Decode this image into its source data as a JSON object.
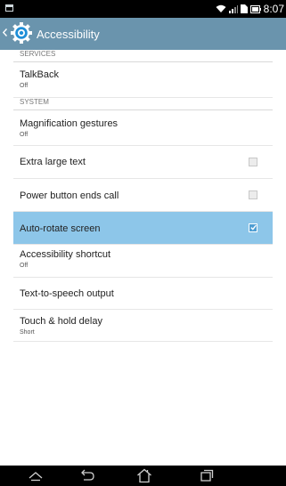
{
  "status_bar": {
    "time": "8:07",
    "icons": [
      "notification-icon",
      "wifi-icon",
      "signal-icon",
      "sim-icon",
      "battery-icon"
    ]
  },
  "action_bar": {
    "title": "Accessibility",
    "background": "#6a94ad",
    "icon": "settings-gear-icon"
  },
  "sections": {
    "services": {
      "header": "SERVICES",
      "items": [
        {
          "title": "TalkBack",
          "summary": "Off"
        }
      ]
    },
    "system": {
      "header": "SYSTEM",
      "items": [
        {
          "title": "Magnification gestures",
          "summary": "Off"
        },
        {
          "title": "Extra large text",
          "checked": false
        },
        {
          "title": "Power button ends call",
          "checked": false
        },
        {
          "title": "Auto-rotate screen",
          "checked": true,
          "selected": true
        },
        {
          "title": "Accessibility shortcut",
          "summary": "Off"
        },
        {
          "title": "Text-to-speech output"
        },
        {
          "title": "Touch & hold delay",
          "summary": "Short"
        }
      ]
    }
  },
  "colors": {
    "selected_row": "#8dc6e9",
    "checkbox_checked": "#4f9ed3"
  },
  "nav_bar": {
    "buttons": [
      "home-caret-icon",
      "back-icon",
      "home-icon",
      "recents-icon"
    ]
  }
}
